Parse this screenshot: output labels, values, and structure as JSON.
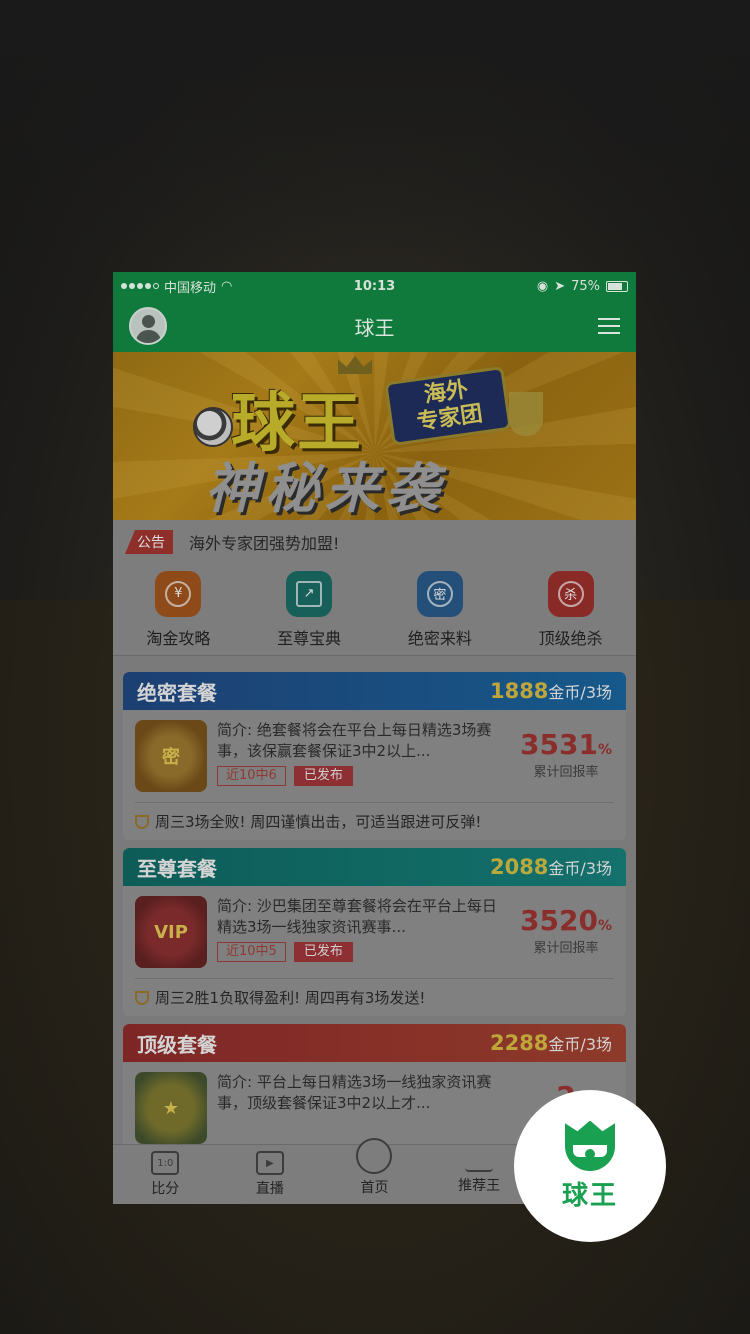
{
  "status_bar": {
    "carrier": "中国移动",
    "time": "10:13",
    "battery": "75%"
  },
  "header": {
    "title": "球王"
  },
  "banner": {
    "line1": "球王",
    "tag_line1": "海外",
    "tag_line2": "专家团",
    "line2": "神秘来袭"
  },
  "notice": {
    "badge": "公告",
    "text": "海外专家团强势加盟!"
  },
  "quick_menu": [
    {
      "label": "淘金攻略",
      "icon": "gold-coin-icon",
      "glyph": "¥"
    },
    {
      "label": "至尊宝典",
      "icon": "chart-book-icon",
      "glyph": "↗"
    },
    {
      "label": "绝密来料",
      "icon": "secret-badge-icon",
      "glyph": "密"
    },
    {
      "label": "顶级绝杀",
      "icon": "target-icon",
      "glyph": "杀"
    }
  ],
  "packages": [
    {
      "name": "绝密套餐",
      "price": "1888",
      "price_unit": "金币/3场",
      "desc": "简介: 绝套餐将会在平台上每日精选3场赛事，该保赢套餐保证3中2以上...",
      "tag_record": "近10中6",
      "tag_status": "已发布",
      "rate": "3531",
      "rate_unit": "%",
      "rate_caption": "累计回报率",
      "thumb": "密",
      "footer": "周三3场全败! 周四谨慎出击，可适当跟进可反弹!"
    },
    {
      "name": "至尊套餐",
      "price": "2088",
      "price_unit": "金币/3场",
      "desc": "简介: 沙巴集团至尊套餐将会在平台上每日精选3场一线独家资讯赛事...",
      "tag_record": "近10中5",
      "tag_status": "已发布",
      "rate": "3520",
      "rate_unit": "%",
      "rate_caption": "累计回报率",
      "thumb": "VIP",
      "footer": "周三2胜1负取得盈利! 周四再有3场发送!"
    },
    {
      "name": "顶级套餐",
      "price": "2288",
      "price_unit": "金币/3场",
      "desc": "简介: 平台上每日精选3场一线独家资讯赛事，顶级套餐保证3中2以上才...",
      "rate": "2",
      "thumb": "★"
    }
  ],
  "tab_bar": [
    {
      "label": "比分",
      "icon": "scoreboard-icon",
      "glyph": "1:0"
    },
    {
      "label": "直播",
      "icon": "tv-icon",
      "glyph": "▶"
    },
    {
      "label": "首页",
      "icon": "home-ball-icon",
      "glyph": ""
    },
    {
      "label": "推荐王",
      "icon": "crown-icon",
      "glyph": ""
    }
  ],
  "app_logo": {
    "text": "球王"
  },
  "colors": {
    "brand_green": "#1aa051",
    "header_green": "#0f7a3c"
  }
}
